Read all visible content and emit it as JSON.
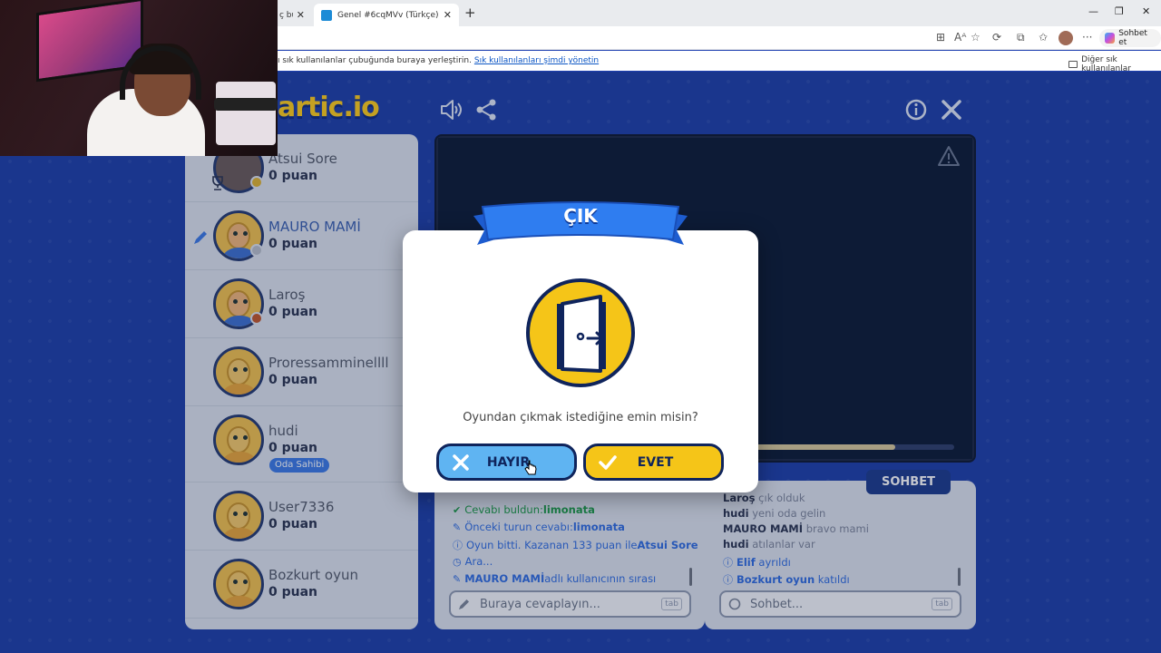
{
  "browser": {
    "tabs": [
      {
        "title": "ç bulu"
      },
      {
        "title": "Genel #6cqMVv (Türkçe) - Gartic.io"
      }
    ],
    "new_tab_symbol": "+",
    "bookmarks_text": "ı sık kullanılanlar çubuğunda buraya yerleştirin.",
    "bookmarks_link": "Sık kullanılanları şimdi yönetin",
    "other_favorites": "Diğer sık kullanılanlar",
    "copilot_label": "Sohbet et"
  },
  "game": {
    "logo": "artic.io",
    "players": [
      {
        "name": "Atsui Sore",
        "points": "0 puan"
      },
      {
        "name": "MAURO MAMİ",
        "points": "0 puan"
      },
      {
        "name": "Laroş",
        "points": "0 puan"
      },
      {
        "name": "Proressamminellll",
        "points": "0 puan"
      },
      {
        "name": "hudi",
        "points": "0 puan",
        "badge": "Oda Sahibi"
      },
      {
        "name": "User7336",
        "points": "0 puan"
      },
      {
        "name": "Bozkurt oyun",
        "points": "0 puan"
      }
    ],
    "progress_fraction": 0.73,
    "answers": {
      "messages": [
        {
          "text": "Cevabı buldun: ",
          "highlight": "limonata"
        },
        {
          "text": "Önceki turun cevabı: ",
          "highlight": "limonata"
        },
        {
          "text": "Oyun bitti. Kazanan 133 puan ile ",
          "highlight": "Atsui Sore"
        },
        {
          "text": "Ara..."
        },
        {
          "highlight": "MAURO MAMİ",
          "text": " adlı kullanıcının sırası"
        }
      ],
      "placeholder": "Buraya cevaplayın...",
      "tab_key": "tab"
    },
    "chat": {
      "tab_label": "SOHBET",
      "messages": [
        {
          "user": "Laroş",
          "text": "çık olduk"
        },
        {
          "user": "hudi",
          "text": "yeni oda gelin"
        },
        {
          "user": "MAURO MAMİ",
          "text": "bravo mami"
        },
        {
          "user": "hudi",
          "text": "atılanlar var"
        },
        {
          "user": "Elif",
          "text": "ayrıldı"
        },
        {
          "user": "Bozkurt oyun",
          "text": "katıldı"
        }
      ],
      "placeholder": "Sohbet...",
      "tab_key": "tab"
    }
  },
  "dialog": {
    "title": "ÇIK",
    "question": "Oyundan çıkmak istediğine emin misin?",
    "no_label": "HAYIR",
    "yes_label": "EVET"
  },
  "colors": {
    "page_bg": "#1c3ea8",
    "banner_blue": "#2f7df0",
    "door_yellow": "#f5c518",
    "no_button": "#5fb4f2",
    "yes_button": "#f5c518",
    "accent_blue": "#2f6be0",
    "accent_green": "#1d9a48"
  }
}
